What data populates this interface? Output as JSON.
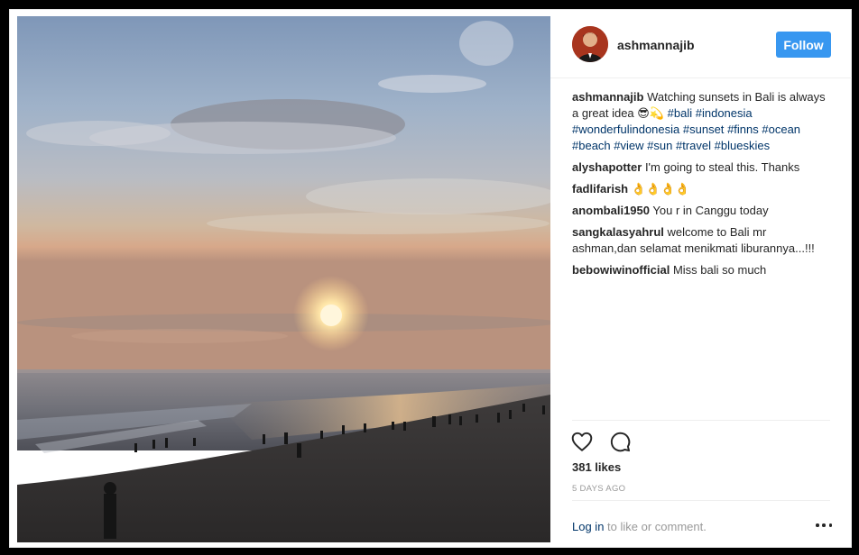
{
  "header": {
    "username": "ashmannajib",
    "follow_label": "Follow"
  },
  "caption": {
    "user": "ashmannajib",
    "text": "Watching sunsets in Bali is always a great idea 😎💫",
    "tags": [
      "#bali",
      "#indonesia",
      "#wonderfulindonesia",
      "#sunset",
      "#finns",
      "#ocean",
      "#beach",
      "#view",
      "#sun",
      "#travel",
      "#blueskies"
    ]
  },
  "comments": [
    {
      "user": "alyshapotter",
      "text": "I'm going to steal this. Thanks"
    },
    {
      "user": "fadlifarish",
      "text": "👌👌👌👌"
    },
    {
      "user": "anombali1950",
      "text": "You r in Canggu today"
    },
    {
      "user": "sangkalasyahrul",
      "text": "welcome to Bali mr ashman,dan selamat menikmati liburannya...!!!"
    },
    {
      "user": "bebowiwinofficial",
      "text": "Miss bali so much"
    }
  ],
  "actions": {
    "like_icon": "heart-icon",
    "comment_icon": "comment-bubble-icon"
  },
  "likes": "381 likes",
  "timestamp": "5 DAYS AGO",
  "login": {
    "link": "Log in",
    "rest": " to like or comment."
  },
  "colors": {
    "follow_button": "#3897f0",
    "hashtag": "#003569",
    "muted": "#999999"
  }
}
